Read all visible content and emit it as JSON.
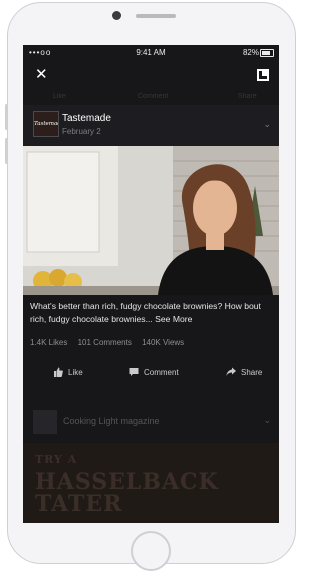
{
  "status_bar": {
    "signal": "•••oo",
    "time": "9:41 AM",
    "battery_pct": "82%"
  },
  "header": {
    "close": "✕"
  },
  "ghost_bar": {
    "items": [
      "Like",
      "Comment",
      "Share"
    ]
  },
  "post": {
    "author": "Tastemade",
    "avatar_text": "Tastemade",
    "date": "February 2",
    "caption": "What's better than rich, fudgy chocolate brownies? How bout rich, fudgy chocolate brownies...",
    "see_more": "See More",
    "likes": "1.4K Likes",
    "comments": "101 Comments",
    "views": "140K Views",
    "actions": {
      "like": "Like",
      "comment": "Comment",
      "share": "Share"
    }
  },
  "next_post": {
    "author": "Cooking Light magazine"
  },
  "ad": {
    "line1": "TRY A",
    "line2": "HASSELBACK",
    "line3": "TATER"
  },
  "colors": {
    "screen_bg": "#17171a",
    "text_primary": "#ffffff",
    "text_muted": "#8d8d93"
  }
}
